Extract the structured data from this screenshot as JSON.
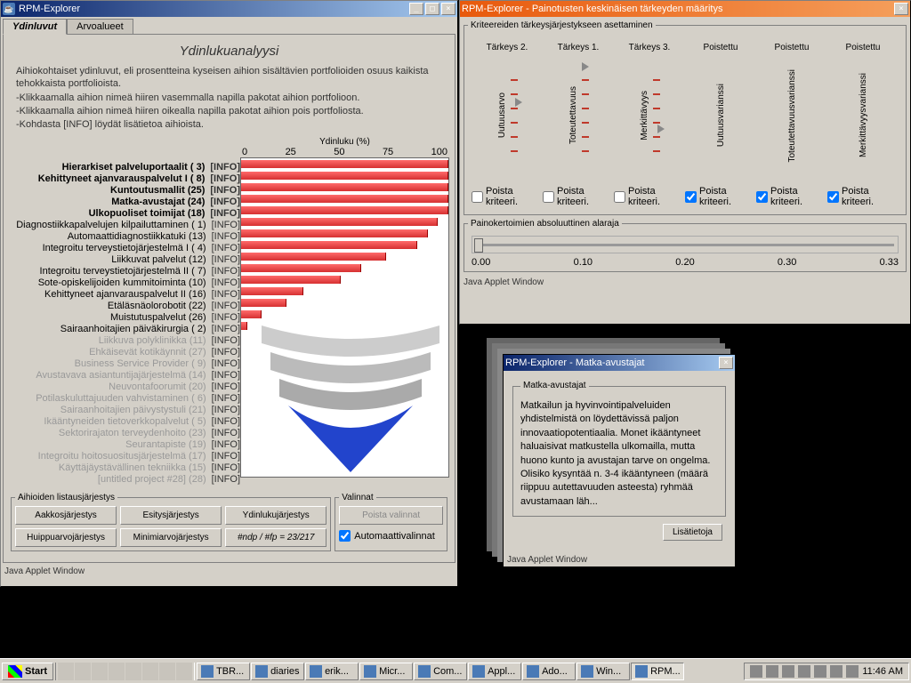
{
  "main_window": {
    "title": "RPM-Explorer",
    "tabs": {
      "active": "Ydinluvut",
      "other": "Arvoalueet"
    },
    "heading": "Ydinlukuanalyysi",
    "desc_main": "Aihiokohtaiset ydinluvut, eli prosentteina kyseisen aihion sisältävien portfolioiden osuus kaikista tehokkaista portfolioista.",
    "desc_1": "-Klikkaamalla aihion nimeä hiiren vasemmalla napilla pakotat aihion portfolioon.",
    "desc_2": "-Klikkaamalla aihion nimeä hiiren oikealla napilla pakotat aihion pois portfoliosta.",
    "desc_3": "-Kohdasta [INFO] löydät lisätietoa aihioista.",
    "xaxis_label": "Ydinluku (%)",
    "info_label": "[INFO]",
    "sort_legend": "Aihioiden listausjärjestys",
    "sort_buttons": [
      "Aakkosjärjestys",
      "Esitysjärjestys",
      "Ydinlukujärjestys",
      "Huippuarvojärjestys",
      "Minimiarvojärjestys"
    ],
    "sort_extra": "#ndp / #fp = 23/217",
    "options_legend": "Valinnat",
    "opt_remove": "Poista valinnat",
    "opt_auto": "Automaattivalinnat",
    "applet": "Java Applet Window"
  },
  "chart_data": {
    "type": "bar",
    "xlabel": "Ydinluku (%)",
    "xlim": [
      0,
      100
    ],
    "ticks": [
      "0",
      "25",
      "50",
      "75",
      "100"
    ],
    "items": [
      {
        "name": "Hierarkiset palveluportaalit",
        "id": "( 3)",
        "v": 100,
        "core": true
      },
      {
        "name": "Kehittyneet ajanvarauspalvelut I",
        "id": "( 8)",
        "v": 100,
        "core": true
      },
      {
        "name": "Kuntoutusmallit",
        "id": "(25)",
        "v": 100,
        "core": true
      },
      {
        "name": "Matka-avustajat",
        "id": "(24)",
        "v": 100,
        "core": true
      },
      {
        "name": "Ulkopuoliset toimijat",
        "id": "(18)",
        "v": 100,
        "core": true
      },
      {
        "name": "Diagnostiikkapalvelujen kilpailuttaminen",
        "id": "( 1)",
        "v": 95,
        "core": false
      },
      {
        "name": "Automaattidiagnostiikkatuki",
        "id": "(13)",
        "v": 90,
        "core": false
      },
      {
        "name": "Integroitu terveystietojärjestelmä I",
        "id": "( 4)",
        "v": 85,
        "core": false
      },
      {
        "name": "Liikkuvat palvelut",
        "id": "(12)",
        "v": 70,
        "core": false
      },
      {
        "name": "Integroitu terveystietojärjestelmä II",
        "id": "( 7)",
        "v": 58,
        "core": false
      },
      {
        "name": "Sote-opiskelijoiden kummitoiminta",
        "id": "(10)",
        "v": 48,
        "core": false
      },
      {
        "name": "Kehittyneet ajanvarauspalvelut II",
        "id": "(16)",
        "v": 30,
        "core": false
      },
      {
        "name": "Etäläsnäolorobotit",
        "id": "(22)",
        "v": 22,
        "core": false
      },
      {
        "name": "Muistutuspalvelut",
        "id": "(26)",
        "v": 10,
        "core": false
      },
      {
        "name": "Sairaanhoitajien päiväkirurgia",
        "id": "( 2)",
        "v": 3,
        "core": false
      },
      {
        "name": "Liikkuva polyklinikka",
        "id": "(11)",
        "v": 0,
        "core": false,
        "grey": true
      },
      {
        "name": "Ehkäisevät kotikäynnit",
        "id": "(27)",
        "v": 0,
        "core": false,
        "grey": true
      },
      {
        "name": "Business Service Provider",
        "id": "( 9)",
        "v": 0,
        "core": false,
        "grey": true
      },
      {
        "name": "Avustavava asiantuntijajärjestelmä",
        "id": "(14)",
        "v": 0,
        "core": false,
        "grey": true
      },
      {
        "name": "Neuvontafoorumit",
        "id": "(20)",
        "v": 0,
        "core": false,
        "grey": true
      },
      {
        "name": "Potilaskuluttajuuden vahvistaminen",
        "id": "( 6)",
        "v": 0,
        "core": false,
        "grey": true
      },
      {
        "name": "Sairaanhoitajien päivystystuli",
        "id": "(21)",
        "v": 0,
        "core": false,
        "grey": true
      },
      {
        "name": "Ikääntyneiden tietoverkkopalvelut",
        "id": "( 5)",
        "v": 0,
        "core": false,
        "grey": true
      },
      {
        "name": "Sektorirajaton terveydenhoito",
        "id": "(23)",
        "v": 0,
        "core": false,
        "grey": true
      },
      {
        "name": "Seurantapiste",
        "id": "(19)",
        "v": 0,
        "core": false,
        "grey": true
      },
      {
        "name": "Integroitu hoitosuositusjärjestelmä",
        "id": "(17)",
        "v": 0,
        "core": false,
        "grey": true
      },
      {
        "name": "Käyttäjäystävällinen tekniikka",
        "id": "(15)",
        "v": 0,
        "core": false,
        "grey": true
      },
      {
        "name": "[untitled project #28]",
        "id": "(28)",
        "v": 0,
        "core": false,
        "grey": true
      }
    ]
  },
  "weight_window": {
    "title": "RPM-Explorer - Painotusten keskinäisen tärkeyden määritys",
    "fieldset_legend": "Kriteereiden tärkeysjärjestykseen asettaminen",
    "criteria": [
      {
        "head": "Tärkeys 2.",
        "label": "Uutuusarvo",
        "removed": false
      },
      {
        "head": "Tärkeys 1.",
        "label": "Toteutettavuus",
        "removed": false
      },
      {
        "head": "Tärkeys 3.",
        "label": "Merkittävyys",
        "removed": false
      },
      {
        "head": "Poistettu",
        "label": "Uutuusvarianssi",
        "removed": true
      },
      {
        "head": "Poistettu",
        "label": "Toteutettavuusvarianssi",
        "removed": true
      },
      {
        "head": "Poistettu",
        "label": "Merkittävyysvarianssi",
        "removed": true
      }
    ],
    "poista": "Poista kriteeri.",
    "slider_legend": "Painokertoimien absoluuttinen alaraja",
    "slider_ticks": [
      "0.00",
      "0.10",
      "0.20",
      "0.30",
      "0.33"
    ],
    "applet": "Java Applet Window"
  },
  "info_window": {
    "title": "RPM-Explorer - Matka-avustajat",
    "legend": "Matka-avustajat",
    "text": "Matkailun ja hyvinvointipalveluiden yhdistelmistä on löydettävissä paljon innovaatiopotentiaalia. Monet ikääntyneet haluaisivat matkustella ulkomailla, mutta huono kunto ja avustajan tarve on ongelma. Olisiko kysyntää n. 3-4 ikääntyneen (määrä riippuu autettavuuden asteesta) ryhmää avustamaan läh...",
    "button": "Lisätietoja",
    "applet": "Java Applet Window"
  },
  "taskbar": {
    "start": "Start",
    "tasks": [
      "TBR...",
      "diaries",
      "erik...",
      "Micr...",
      "Com...",
      "Appl...",
      "Ado...",
      "Win...",
      "RPM..."
    ],
    "time": "11:46 AM"
  }
}
